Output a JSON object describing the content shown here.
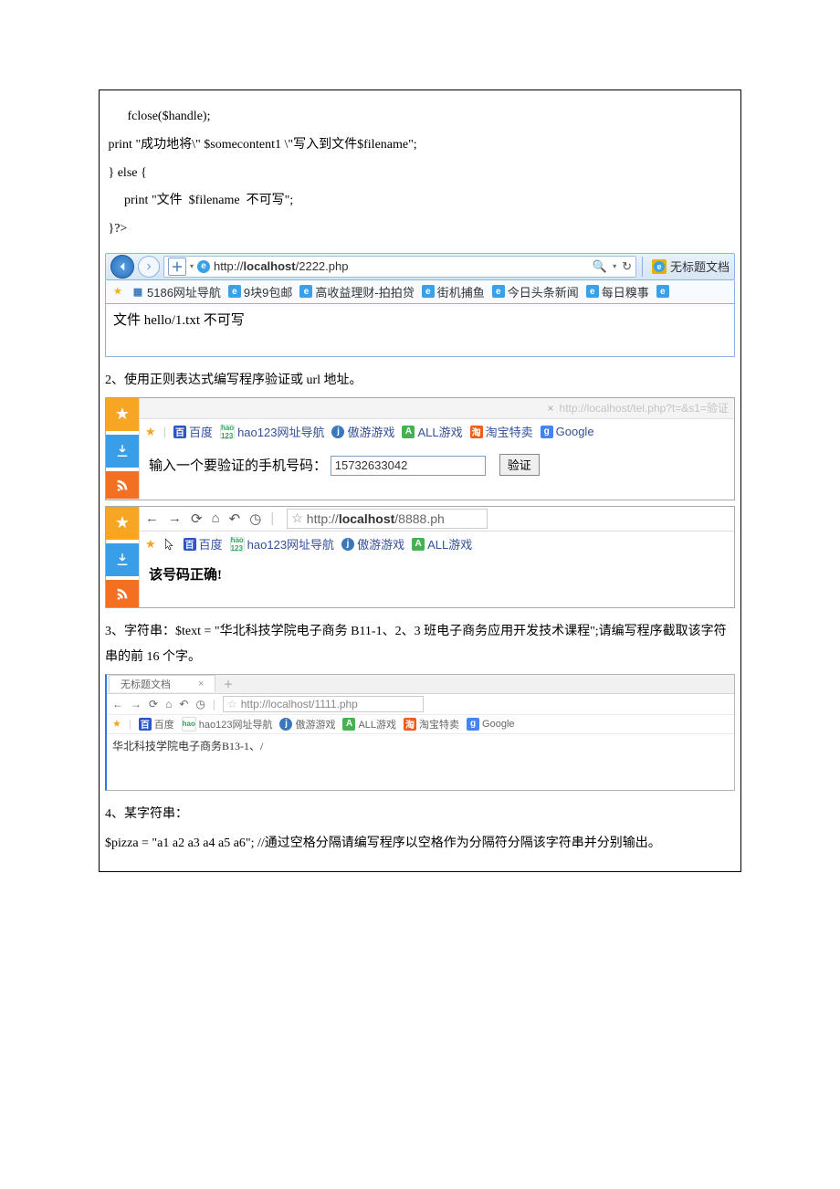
{
  "code_block_1": "       fclose($handle);\n print \"成功地将\\\" $somecontent1 \\\"写入到文件$filename\";\n } else {\n      print \"文件  $filename  不可写\";\n }?>",
  "q2": "2、使用正则表达式编写程序验证或 url 地址。",
  "q3": "3、字符串：$text = \"华北科技学院电子商务 B11-1、2、3 班电子商务应用开发技术课程\";请编写程序截取该字符串的前 16 个字。",
  "q4_a": "4、某字符串：",
  "q4_b": "$pizza   = \"a1 a2 a3 a4 a5 a6\";   //通过空格分隔请编写程序以空格作为分隔符分隔该字符串并分别输出。",
  "ie": {
    "url_prefix": "http://",
    "url_host": "localhost",
    "url_path": "/2222.php",
    "tab_title": "无标题文档",
    "bookmarks": [
      "5186网址导航",
      "9块9包邮",
      "高收益理财-拍拍贷",
      "街机捕鱼",
      "今日头条新闻",
      "每日糗事"
    ],
    "content": "文件 hello/1.txt 不可写"
  },
  "b2a": {
    "faded_url": "http://localhost/tel.php?t=&s1=验证",
    "links": [
      "百度",
      "hao123网址导航",
      "傲游游戏",
      "ALL游戏",
      "淘宝特卖",
      "Google"
    ],
    "label": "输入一个要验证的手机号码：",
    "input_value": "15732633042",
    "button": "验证"
  },
  "b2b": {
    "url_prefix": "http://",
    "url_host": "localhost",
    "url_path": "/8888.ph",
    "links": [
      "百度",
      "hao123网址导航",
      "傲游游戏",
      "ALL游戏"
    ],
    "content": "该号码正确!"
  },
  "b4": {
    "tab": "无标题文档",
    "url": "http://localhost/1111.php",
    "links": [
      "百度",
      "hao123网址导航",
      "傲游游戏",
      "ALL游戏",
      "淘宝特卖",
      "Google"
    ],
    "content": "华北科技学院电子商务B13-1、/"
  }
}
